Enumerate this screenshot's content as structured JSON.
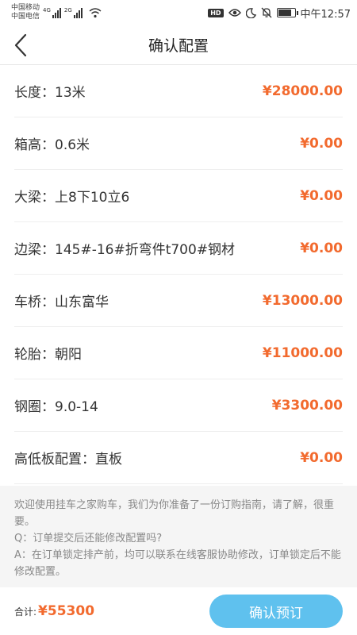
{
  "status": {
    "carrier1": "中国移动",
    "carrier2": "中国电信",
    "net1": "4G",
    "net2": "2G",
    "hd": "HD",
    "time": "中午12:57"
  },
  "nav": {
    "title": "确认配置"
  },
  "items": [
    {
      "label": "长度：13米",
      "price": "¥28000.00"
    },
    {
      "label": "箱高：0.6米",
      "price": "¥0.00"
    },
    {
      "label": "大梁：上8下10立6",
      "price": "¥0.00"
    },
    {
      "label": "边梁：145#-16#折弯件t700#钢材",
      "price": "¥0.00"
    },
    {
      "label": "车桥：山东富华",
      "price": "¥13000.00"
    },
    {
      "label": "轮胎：朝阳",
      "price": "¥11000.00"
    },
    {
      "label": "钢圈：9.0-14",
      "price": "¥3300.00"
    },
    {
      "label": "高低板配置：直板",
      "price": "¥0.00"
    }
  ],
  "guide": {
    "intro": "欢迎使用挂车之家购车，我们为你准备了一份订购指南，请了解，很重要。",
    "q": "Q：订单提交后还能修改配置吗?",
    "a": "A：在订单锁定排产前，均可以联系在线客服协助修改，订单锁定后不能修改配置。"
  },
  "footer": {
    "total_label": "合计:",
    "total_value": "¥55300",
    "confirm_label": "确认预订"
  },
  "colors": {
    "price": "#f26a2e",
    "button": "#5fc1ee"
  },
  "icons": {
    "back": "chevron-left-icon",
    "eye": "eye-icon",
    "moon": "moon-icon",
    "mute": "bell-off-icon",
    "wifi": "wifi-icon",
    "battery": "battery-icon"
  },
  "battery_level": 0.85
}
